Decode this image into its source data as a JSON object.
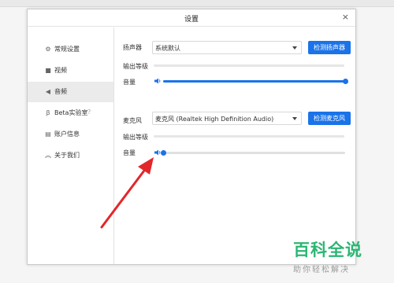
{
  "window": {
    "title": "设置",
    "close_glyph": "×"
  },
  "sidebar": {
    "items": [
      {
        "label": "常规设置",
        "icon": "gear-icon",
        "glyph": "⚙",
        "active": false
      },
      {
        "label": "视频",
        "icon": "video-camera-icon",
        "glyph": "■",
        "active": false
      },
      {
        "label": "音频",
        "icon": "speaker-icon",
        "glyph": "◀",
        "active": true
      },
      {
        "label": "Beta实验室",
        "icon": "beta-icon",
        "glyph": "β",
        "active": false
      },
      {
        "label": "账户信息",
        "icon": "account-icon",
        "glyph": "▤",
        "active": false
      },
      {
        "label": "关于我们",
        "icon": "about-icon",
        "glyph": "︽",
        "active": false
      }
    ],
    "help_glyph": "?"
  },
  "speaker": {
    "label": "扬声器",
    "device": "系统默认",
    "test_button": "检测扬声器",
    "output_level_label": "输出等级",
    "output_level": 0,
    "volume_label": "音量",
    "volume": 1.0
  },
  "microphone": {
    "label": "麦克风",
    "device": "麦克风 (Realtek High Definition Audio)",
    "test_button": "检测麦克风",
    "output_level_label": "输出等级",
    "output_level": 0,
    "volume_label": "音量",
    "volume": 0.0
  },
  "colors": {
    "accent": "#1a73e8",
    "arrow": "#e3262a",
    "watermark": "#2bb673"
  },
  "watermark": {
    "title": "百科全说",
    "subtitle": "助你轻松解决"
  }
}
